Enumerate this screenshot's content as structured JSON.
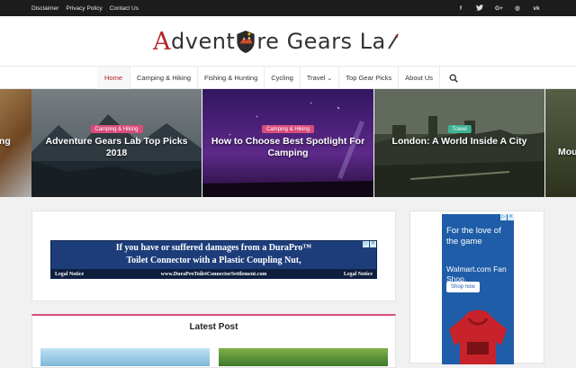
{
  "topbar": {
    "links": [
      "Disclaimer",
      "Privacy Policy",
      "Contact Us"
    ],
    "social": [
      {
        "icon": "facebook-icon",
        "glyph": "f"
      },
      {
        "icon": "twitter-icon",
        "glyph": "t"
      },
      {
        "icon": "google-plus-icon",
        "glyph": "G+"
      },
      {
        "icon": "instagram-icon",
        "glyph": "◎"
      },
      {
        "icon": "vk-icon",
        "glyph": "vk"
      }
    ]
  },
  "header": {
    "logo_first": "A",
    "logo_mid": "dvent",
    "logo_rest": "re Gears La"
  },
  "nav": {
    "items": [
      "Home",
      "Camping & Hiking",
      "Fishing & Hunting",
      "Cycling",
      "Travel",
      "Top Gear Picks",
      "About Us"
    ],
    "travel_caret": "⌄",
    "search_icon": "search-icon"
  },
  "slider": {
    "partial_left_text": "ing",
    "slides": [
      {
        "category": "Camping & Hiking",
        "title": "Adventure Gears Lab Top Picks 2018"
      },
      {
        "category": "Camping & Hiking",
        "title": "How to Choose Best Spotlight For Camping"
      },
      {
        "category": "Travel",
        "title": "London: A World Inside A City"
      }
    ],
    "partial_right_text": "Mou b"
  },
  "ad_banner": {
    "line1": "If you have or suffered damages from a DuraPro™",
    "line2": "Toilet Connector with a Plastic Coupling Nut,",
    "note_left": "Legal Notice",
    "note_center": "www.DuraProToiletConnectorSettlement.com",
    "note_right": "Legal Notice"
  },
  "latest": {
    "heading": "Latest Post"
  },
  "sidebar_ad": {
    "tagline": "For the love of the game",
    "brand_line": "Walmart.com Fan Shop.",
    "button": "Shop now"
  },
  "colors": {
    "accent": "#b3232a",
    "pink_badge": "#d84d7a",
    "green_badge": "#3db394",
    "topbar": "#1c1c1c"
  }
}
